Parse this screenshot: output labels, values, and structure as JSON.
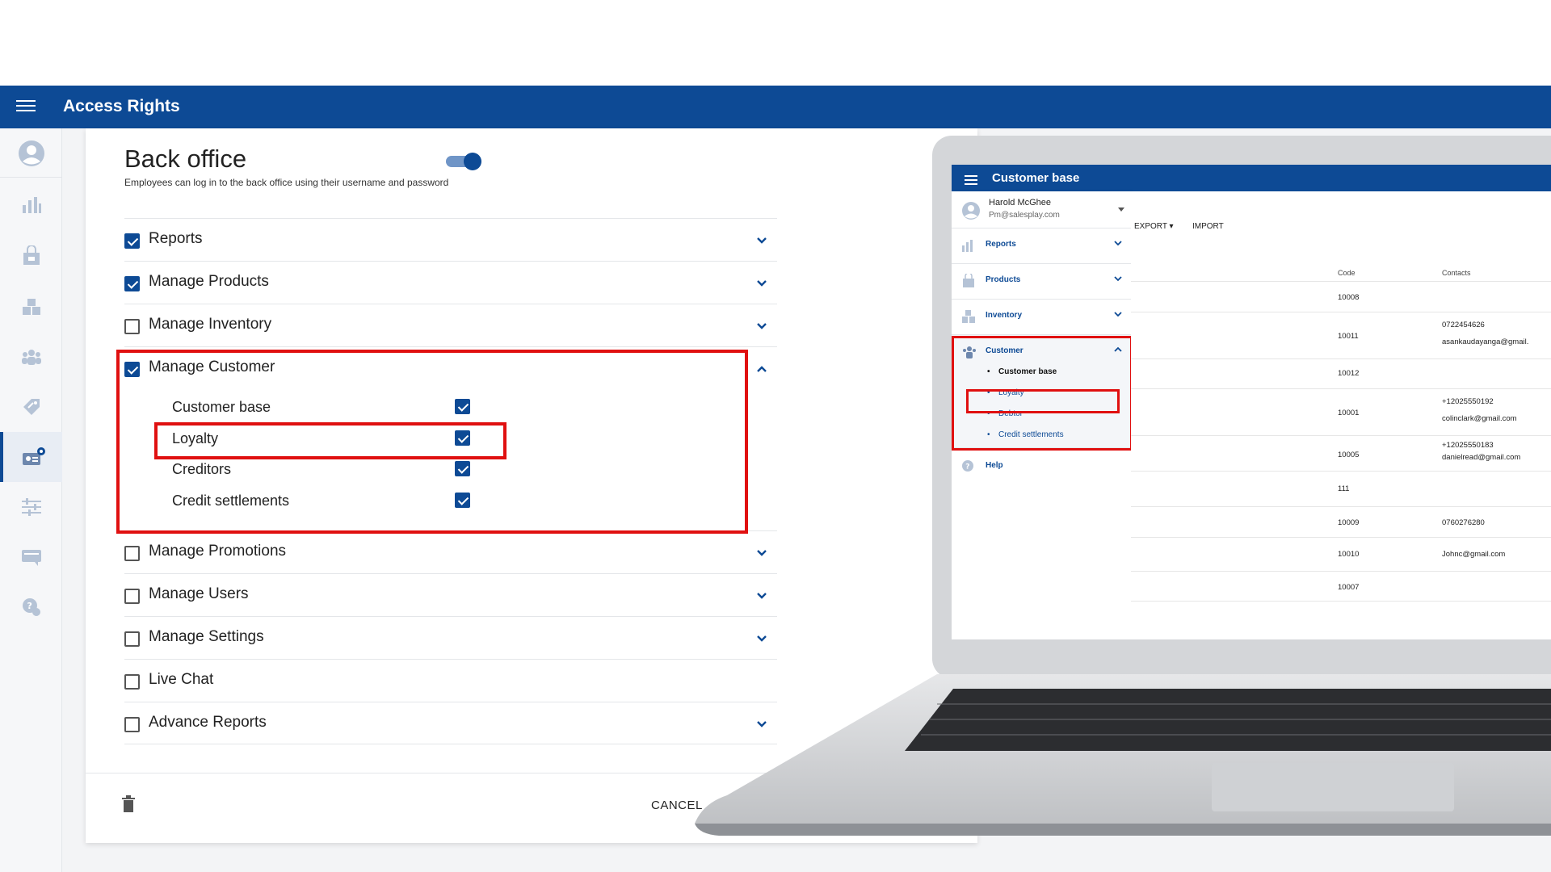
{
  "app": {
    "title": "Access Rights"
  },
  "colors": {
    "primary": "#0d4a95",
    "highlight": "#e01010"
  },
  "rail": {
    "icons": [
      "user-icon",
      "reports-icon",
      "products-icon",
      "inventory-icon",
      "customers-icon",
      "promotions-icon",
      "customer-admin-icon",
      "settings-icon",
      "chat-icon",
      "help-icon"
    ]
  },
  "card": {
    "title": "Back office",
    "subtitle": "Employees can log in to the back office using their username and password",
    "enabled": true,
    "permissions": [
      {
        "label": "Reports",
        "checked": true,
        "expandable": true
      },
      {
        "label": "Manage Products",
        "checked": true,
        "expandable": true
      },
      {
        "label": "Manage Inventory",
        "checked": false,
        "expandable": true
      },
      {
        "label": "Manage Customer",
        "checked": true,
        "expandable": true,
        "expanded": true
      },
      {
        "label": "Manage Promotions",
        "checked": false,
        "expandable": true
      },
      {
        "label": "Manage Users",
        "checked": false,
        "expandable": true
      },
      {
        "label": "Manage Settings",
        "checked": false,
        "expandable": true
      },
      {
        "label": "Live Chat",
        "checked": false,
        "expandable": false
      },
      {
        "label": "Advance Reports",
        "checked": false,
        "expandable": true
      }
    ],
    "customer_sub": [
      {
        "label": "Customer base",
        "checked": true
      },
      {
        "label": "Loyalty",
        "checked": true
      },
      {
        "label": "Creditors",
        "checked": true
      },
      {
        "label": "Credit settlements",
        "checked": true
      }
    ],
    "cancel_label": "CANCEL"
  },
  "laptop": {
    "title": "Customer base",
    "user": {
      "name": "Harold McGhee",
      "email": "Pm@salesplay.com"
    },
    "nav": [
      "Reports",
      "Products",
      "Inventory",
      "Customer",
      "Help"
    ],
    "customer_sub": [
      "Customer base",
      "Loyalty",
      "Debtor",
      "Credit settlements"
    ],
    "toolbar": {
      "export": "EXPORT",
      "import": "IMPORT"
    },
    "columns": {
      "code": "Code",
      "contacts": "Contacts"
    },
    "rows": [
      {
        "code": "10008",
        "contact1": "",
        "contact2": ""
      },
      {
        "code": "10011",
        "contact1": "0722454626",
        "contact2": "asankaudayanga@gmail."
      },
      {
        "code": "10012",
        "contact1": "",
        "contact2": ""
      },
      {
        "code": "10001",
        "contact1": "+12025550192",
        "contact2": "colinclark@gmail.com"
      },
      {
        "code": "10005",
        "contact1": "+12025550183",
        "contact2": "danielread@gmail.com"
      },
      {
        "code": "111",
        "contact1": "",
        "contact2": ""
      },
      {
        "code": "10009",
        "contact1": "0760276280",
        "contact2": ""
      },
      {
        "code": "10010",
        "contact1": "Johnc@gmail.com",
        "contact2": ""
      },
      {
        "code": "10007",
        "contact1": "",
        "contact2": ""
      }
    ]
  }
}
